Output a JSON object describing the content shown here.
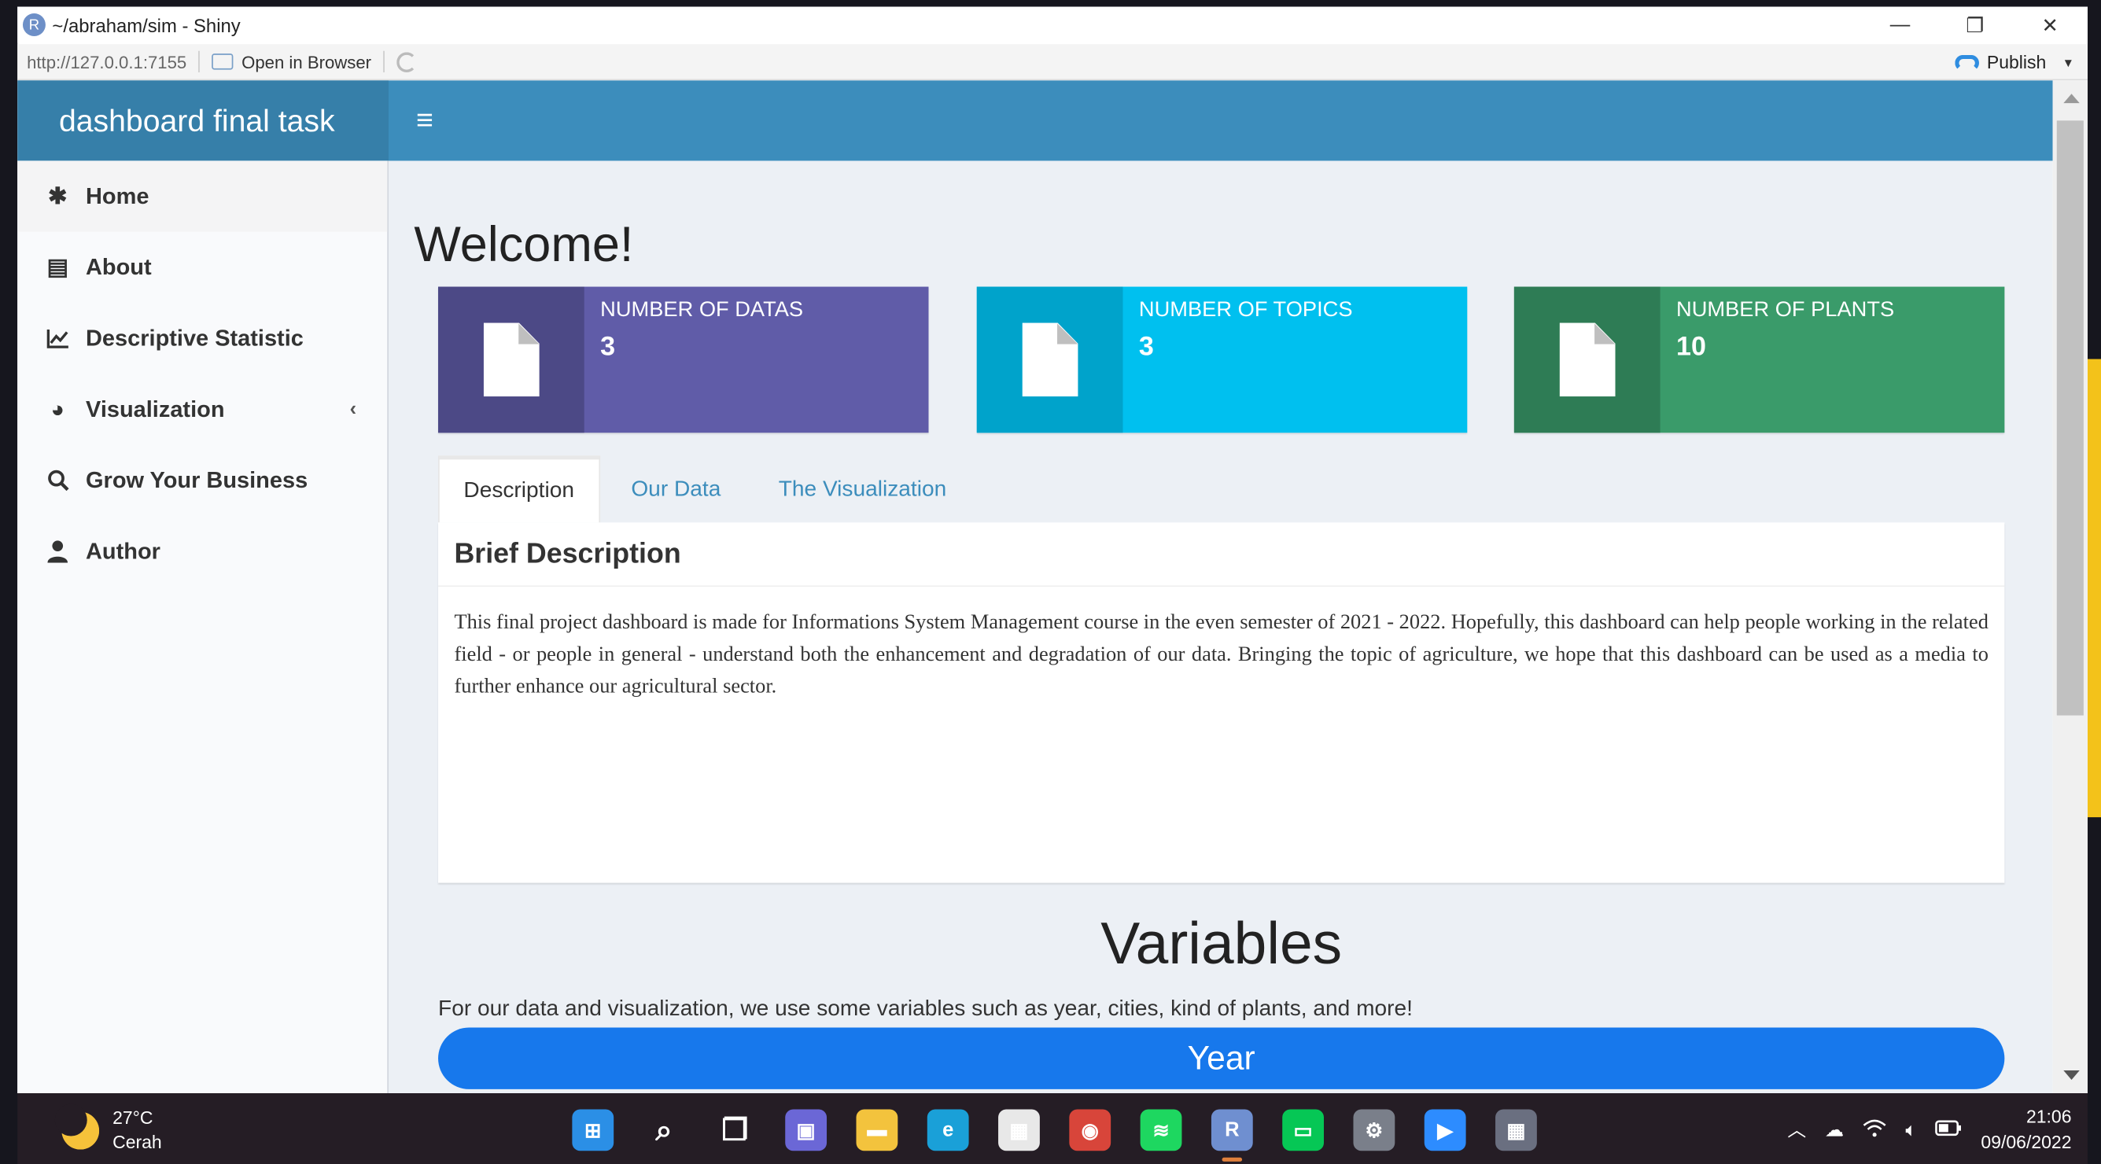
{
  "window": {
    "title": "~/abraham/sim - Shiny",
    "app_icon": "R",
    "url": "http://127.0.0.1:7155",
    "open_in_browser": "Open in Browser",
    "publish": "Publish"
  },
  "header": {
    "brand": "dashboard final task"
  },
  "sidebar": {
    "items": [
      {
        "label": "Home",
        "icon": "asterisk-icon",
        "glyph": "✱"
      },
      {
        "label": "About",
        "icon": "book-icon",
        "glyph": "▤"
      },
      {
        "label": "Descriptive Statistic",
        "icon": "line-chart-icon",
        "glyph": "📈"
      },
      {
        "label": "Visualization",
        "icon": "pie-chart-icon",
        "glyph": "◕"
      },
      {
        "label": "Grow Your Business",
        "icon": "search-icon",
        "glyph": "⌕"
      },
      {
        "label": "Author",
        "icon": "user-icon",
        "glyph": "👤"
      }
    ],
    "visualization_chevron": "‹"
  },
  "main": {
    "welcome": "Welcome!",
    "infoboxes": [
      {
        "label": "NUMBER OF DATAS",
        "value": "3",
        "color": "#605ca8",
        "icon_bg": "#4c4986"
      },
      {
        "label": "NUMBER OF TOPICS",
        "value": "3",
        "color": "#00c0ef",
        "icon_bg": "#00a3cb"
      },
      {
        "label": "NUMBER OF PLANTS",
        "value": "10",
        "color": "#3a9b6a",
        "icon_bg": "#2e7c55"
      }
    ],
    "tabs": [
      "Description",
      "Our Data",
      "The Visualization"
    ],
    "panel_title": "Brief Description",
    "panel_body": "This final project dashboard is made for Informations System Management course in the even semester of 2021 - 2022. Hopefully, this dashboard can help people working in the related field - or people in general - understand both the enhancement and degradation of our data. Bringing the topic of agriculture, we hope that this dashboard can be used as a media to further enhance our agricultural sector.",
    "variables_title": "Variables",
    "variables_desc": "For our data and visualization, we use some variables such as year, cities, kind of plants, and more!",
    "year_button": "Year"
  },
  "taskbar": {
    "temperature": "27°C",
    "weather": "Cerah",
    "time": "21:06",
    "date": "09/06/2022",
    "apps": [
      {
        "name": "start-icon",
        "bg": "#2b8fe6",
        "glyph": "⊞"
      },
      {
        "name": "search-icon",
        "bg": "transparent",
        "glyph": "⌕"
      },
      {
        "name": "task-view-icon",
        "bg": "transparent",
        "glyph": "❐"
      },
      {
        "name": "teams-chat-icon",
        "bg": "#6b67d6",
        "glyph": "▣"
      },
      {
        "name": "file-explorer-icon",
        "bg": "#f3c33d",
        "glyph": "▬"
      },
      {
        "name": "edge-icon",
        "bg": "#1aa0d8",
        "glyph": "e"
      },
      {
        "name": "store-icon",
        "bg": "#e8e8e8",
        "glyph": "▦"
      },
      {
        "name": "chrome-icon",
        "bg": "#d8453a",
        "glyph": "◉"
      },
      {
        "name": "spotify-icon",
        "bg": "#1ed760",
        "glyph": "≋"
      },
      {
        "name": "rstudio-icon",
        "bg": "#6f8fd0",
        "glyph": "R"
      },
      {
        "name": "line-icon",
        "bg": "#06c755",
        "glyph": "▭"
      },
      {
        "name": "settings-icon",
        "bg": "#7a7f8a",
        "glyph": "⚙"
      },
      {
        "name": "zoom-icon",
        "bg": "#2d8cff",
        "glyph": "▶"
      },
      {
        "name": "calculator-icon",
        "bg": "#6a6f80",
        "glyph": "▦"
      }
    ]
  }
}
